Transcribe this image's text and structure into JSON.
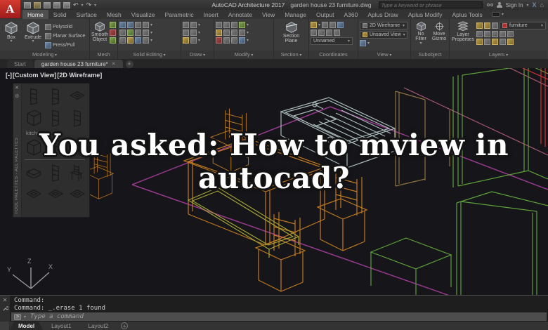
{
  "titlebar": {
    "logo": "A",
    "title_app": "AutoCAD Architecture 2017",
    "title_doc": "garden house 23 furniture.dwg",
    "search_placeholder": "Type a keyword or phrase",
    "sign_in": "Sign In"
  },
  "glyphs": {
    "close": "✕",
    "undo": "↶",
    "redo": "↷",
    "plus": "+",
    "home": "⌂",
    "x_brand": "X"
  },
  "ribbon": {
    "tabs": [
      "Home",
      "Solid",
      "Surface",
      "Mesh",
      "Visualize",
      "Parametric",
      "Insert",
      "Annotate",
      "View",
      "Manage",
      "Output",
      "A360",
      "Aplus Draw",
      "Aplus Modify",
      "Aplus Tools"
    ],
    "panels": {
      "modeling": {
        "label": "Modeling",
        "box": "Box",
        "extrude": "Extrude",
        "polysolid": "Polysolid",
        "planar_surface": "Planar Surface",
        "press_pull": "Press/Pull"
      },
      "mesh": {
        "label": "Mesh",
        "smooth_object": "Smooth Object"
      },
      "solid_editing": {
        "label": "Solid Editing"
      },
      "draw": {
        "label": "Draw"
      },
      "modify": {
        "label": "Modify"
      },
      "section": {
        "label": "Section",
        "section_plane": "Section Plane"
      },
      "coordinates": {
        "label": "Coordinates",
        "ucs_name": "Unnamed"
      },
      "view": {
        "label": "View",
        "visual_style": "2D Wireframe",
        "named_view": "Unsaved View"
      },
      "subobject": {
        "label": "Subobject",
        "no_filter": "No Filter",
        "move_gizmo": "Move Gizmo"
      },
      "layers": {
        "label": "Layers",
        "layer_properties": "Layer Properties",
        "current_layer": "furniture"
      }
    }
  },
  "file_tabs": {
    "start": "Start",
    "active_doc": "garden house 23 furniture*"
  },
  "canvas": {
    "vp": {
      "minus": "[-]",
      "view": "[Custom View]",
      "style": "[2D Wireframe]"
    },
    "overlay_title": "You asked: How to mview in autocad?",
    "ucs": {
      "x": "X",
      "y": "Y",
      "z": "Z"
    }
  },
  "tool_palettes": {
    "title": "TOOL PALETTES - ALL PALETTES",
    "group_label": "kitchen"
  },
  "command": {
    "line1": "Command:",
    "line2": "Command: _.erase 1 found",
    "placeholder": "Type a command"
  },
  "layout_tabs": {
    "model": "Model",
    "layout1": "Layout1",
    "layout2": "Layout2"
  },
  "colors": {
    "wire_magenta": "#963a8c",
    "wire_rose": "#a85a70",
    "wire_gray": "#a9bab8",
    "wire_orange": "#c07a1e",
    "wire_yellow": "#a3a335",
    "wire_green": "#5fa13a",
    "wire_tan": "#8f7340",
    "wire_red": "#bb3333",
    "accent_red": "#c03c3c"
  }
}
